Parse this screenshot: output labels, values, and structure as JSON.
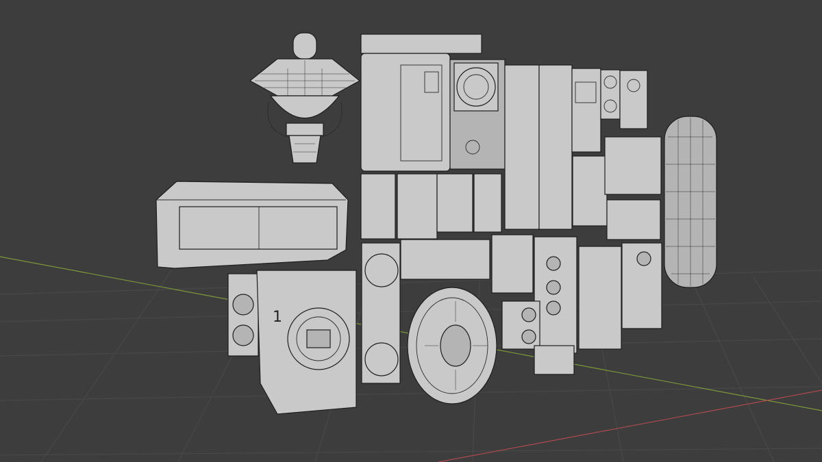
{
  "viewport": {
    "background": "#3d3d3d",
    "grid_color": "#4a4a4a",
    "x_axis_color": "#b04a50",
    "y_axis_color": "#7c9a3a",
    "object_fill": "#c9c9c9",
    "wire_color": "#1d1d1d"
  },
  "objects": {
    "panel_number": "1"
  }
}
